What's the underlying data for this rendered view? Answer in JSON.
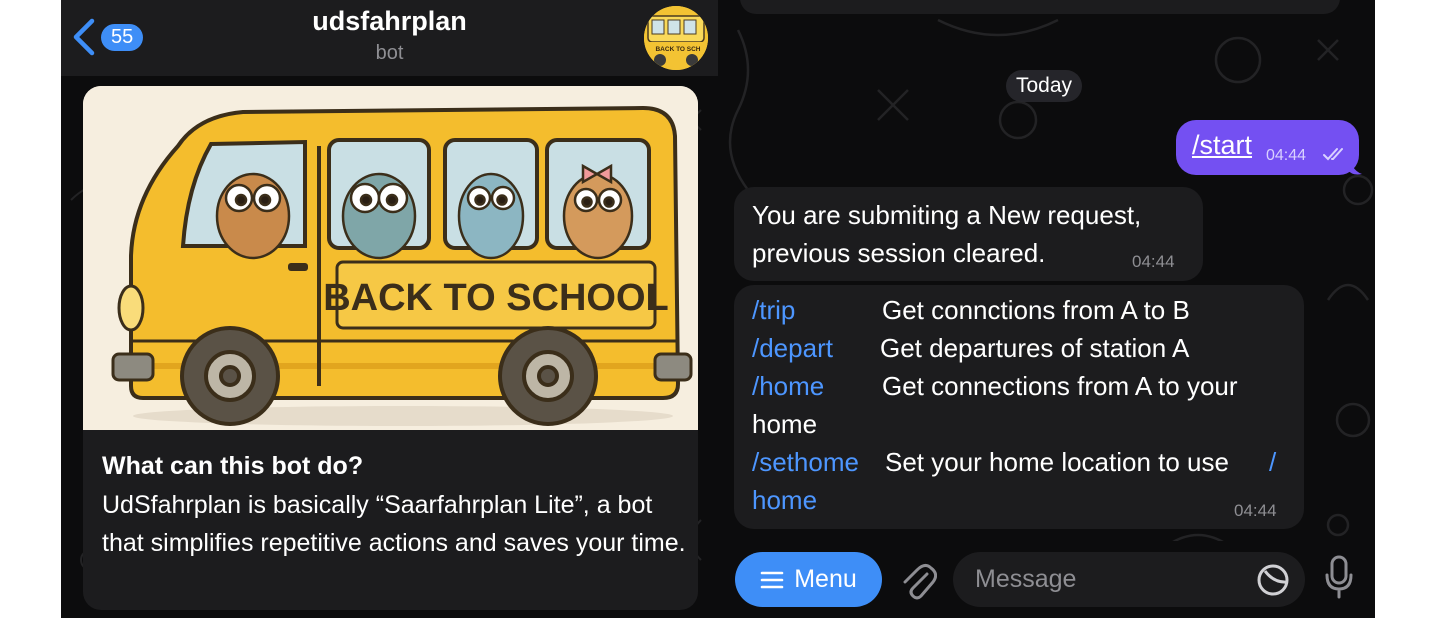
{
  "header": {
    "back_badge": "55",
    "title": "udsfahrplan",
    "subtitle": "bot",
    "avatar_text": "BACK TO SCH"
  },
  "intro": {
    "image_text": "BACK TO SCHOOL",
    "title": "What can this bot do?",
    "body": "UdSfahrplan is basically “Saarfahrplan Lite”, a bot that simplifies repetitive actions and saves your time."
  },
  "chat": {
    "date": "Today",
    "outgoing": {
      "text": "/start",
      "time": "04:44",
      "status": "read"
    },
    "incoming1": {
      "line1": "You are submiting a New request,",
      "line2": "previous session cleared.",
      "time": "04:44"
    },
    "incoming2": {
      "commands": [
        {
          "cmd": "/trip",
          "desc": "Get connctions from A to B"
        },
        {
          "cmd": "/depart",
          "desc": "Get departures of station A"
        },
        {
          "cmd": "/home",
          "desc": "Get connections from A to your",
          "desc2": "home"
        },
        {
          "cmd": "/sethome",
          "desc": "Set your home location to use",
          "link_tail_1": "/",
          "link_tail_2": "home"
        }
      ],
      "time": "04:44"
    }
  },
  "input_bar": {
    "menu_label": "Menu",
    "placeholder": "Message"
  },
  "icons": [
    "chevron-left-icon",
    "attach-icon",
    "sticker-icon",
    "mic-icon",
    "menu-lines-icon",
    "read-ticks-icon"
  ],
  "colors": {
    "accent": "#3e8ef7",
    "outgoing_bubble": "#7450f2",
    "incoming_bubble": "#1c1c1e",
    "link": "#4d96ff",
    "background": "#0c0c0d"
  }
}
